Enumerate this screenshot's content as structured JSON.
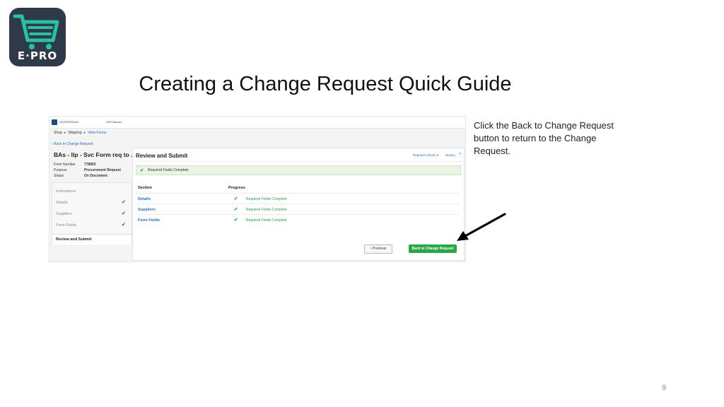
{
  "logo": {
    "brand_text": "E·PRO",
    "icon": "shopping-cart-icon"
  },
  "slide": {
    "title": "Creating a Change Request Quick Guide",
    "page_number": "9"
  },
  "instruction": "Click the Back to Change Request button to return to the Change Request.",
  "app": {
    "topbar": {
      "brand": "UNIVERSIDAD",
      "secondary": "UNF Banner"
    },
    "breadcrumbs": [
      "Shop",
      "Shipping",
      "View Forms"
    ],
    "back_link": "Back to Change Request",
    "form_title": "BAs - llp - Svc Form req to ...",
    "meta": [
      {
        "label": "Form Number",
        "value": "778852"
      },
      {
        "label": "Purpose",
        "value": "Procurement Request"
      },
      {
        "label": "Status",
        "value": "On Document"
      }
    ],
    "sidebar": [
      {
        "label": "Instructions",
        "complete": false
      },
      {
        "label": "Details",
        "complete": true
      },
      {
        "label": "Suppliers",
        "complete": true
      },
      {
        "label": "Form Fields",
        "complete": true
      }
    ],
    "sidebar_active": "Review and Submit",
    "main": {
      "heading": "Review and Submit",
      "actions": "Request Actions ▾",
      "history": "History",
      "help": "?",
      "banner": "Required Fields Complete",
      "col_section": "Section",
      "col_progress": "Progress",
      "rows": [
        {
          "section": "Details",
          "progress": "Required Fields Complete"
        },
        {
          "section": "Suppliers",
          "progress": "Required Fields Complete"
        },
        {
          "section": "Form Fields",
          "progress": "Required Fields Complete"
        }
      ],
      "previous_button": "‹ Previous",
      "back_button": "Back to Change Request"
    }
  },
  "colors": {
    "accent_green": "#28a745",
    "link_blue": "#2a6ebb",
    "logo_bg": "#2f3a48"
  }
}
